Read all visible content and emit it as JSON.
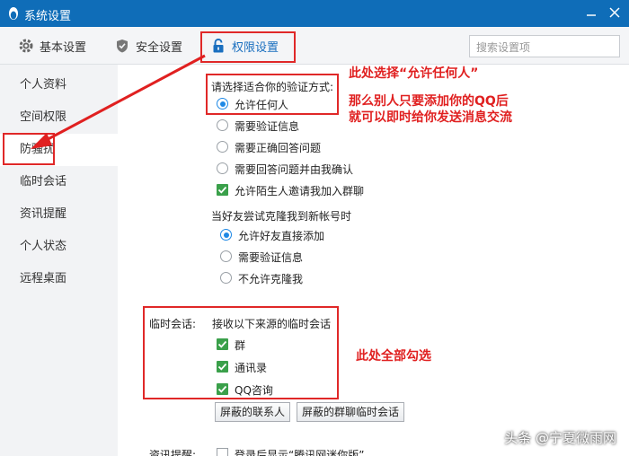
{
  "window": {
    "title": "系统设置"
  },
  "tabs": [
    {
      "label": "基本设置",
      "icon": "gear-icon"
    },
    {
      "label": "安全设置",
      "icon": "shield-icon"
    },
    {
      "label": "权限设置",
      "icon": "lock-icon"
    }
  ],
  "search": {
    "placeholder": "搜索设置项"
  },
  "sidebar": {
    "items": [
      {
        "label": "个人资料"
      },
      {
        "label": "空间权限"
      },
      {
        "label": "防骚扰"
      },
      {
        "label": "临时会话"
      },
      {
        "label": "资讯提醒"
      },
      {
        "label": "个人状态"
      },
      {
        "label": "远程桌面"
      }
    ]
  },
  "verify": {
    "label": "请选择适合你的验证方式:",
    "options": [
      "允许任何人",
      "需要验证信息",
      "需要正确回答问题",
      "需要回答问题并由我确认"
    ],
    "selected": 0,
    "allow_group_invite": "允许陌生人邀请我加入群聊"
  },
  "clone": {
    "label": "当好友尝试克隆我到新帐号时",
    "options": [
      "允许好友直接添加",
      "需要验证信息",
      "不允许克隆我"
    ],
    "selected": 0
  },
  "temp_session": {
    "label": "临时会话:",
    "sub_label": "接收以下来源的临时会话",
    "options": [
      "群",
      "通讯录",
      "QQ咨询"
    ],
    "blocked_contacts_button": "屏蔽的联系人",
    "blocked_group_button": "屏蔽的群聊临时会话"
  },
  "news": {
    "label": "资讯提醒:",
    "option": "登录后显示“腾讯网迷你版”"
  },
  "annotations": {
    "top": "此处选择“允许任何人”",
    "line2": "那么别人只要添加你的QQ后",
    "line3": "就可以即时给你发送消息交流",
    "all_check": "此处全部勾选",
    "watermark": "头条 @宁夏微雨网"
  }
}
